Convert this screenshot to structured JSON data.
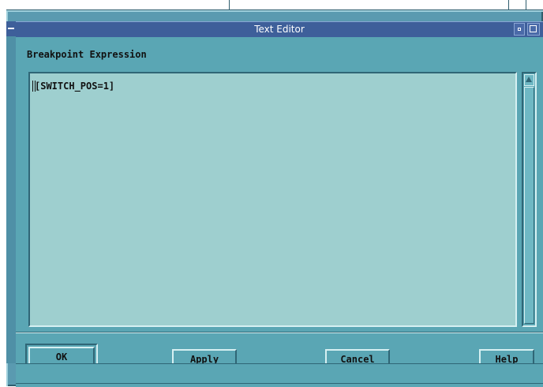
{
  "window": {
    "title": "Text Editor"
  },
  "editor": {
    "heading": "Breakpoint Expression",
    "content": "[SWITCH_POS=1]"
  },
  "buttons": {
    "ok": "OK",
    "apply": "Apply",
    "cancel": "Cancel",
    "help": "Help"
  },
  "icons": {
    "window_menu": "window-menu-icon",
    "minimize": "minimize-icon",
    "maximize": "maximize-icon",
    "scroll_up": "scroll-up-arrow-icon",
    "text_cursor": "text-cursor-icon"
  },
  "colors": {
    "titlebar": "#3e5f9a",
    "client_bg": "#5aa6b4",
    "text_area_bg": "#9ecfcf"
  }
}
